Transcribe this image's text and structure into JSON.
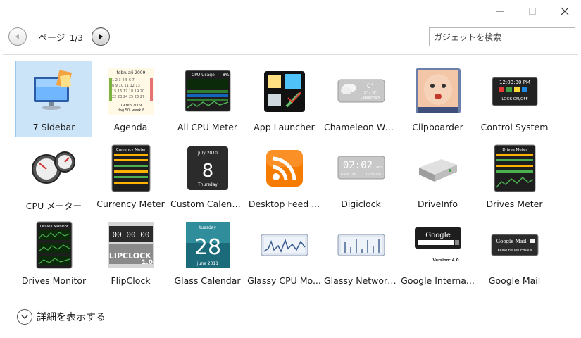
{
  "window": {
    "minimize_icon": "minimize-icon",
    "maximize_icon": "maximize-icon",
    "close_icon": "close-icon"
  },
  "nav": {
    "page_label": "ページ",
    "page_number": "1/3"
  },
  "search": {
    "placeholder": "ガジェットを検索"
  },
  "gadgets": [
    {
      "label": "7 Sidebar",
      "icon": "monitor-icon",
      "selected": true
    },
    {
      "label": "Agenda",
      "icon": "calendar-icon"
    },
    {
      "label": "All CPU Meter",
      "icon": "cpu-graph-icon"
    },
    {
      "label": "App Launcher",
      "icon": "app-launcher-icon"
    },
    {
      "label": "Chameleon We...",
      "icon": "weather-icon"
    },
    {
      "label": "Clipboarder",
      "icon": "baby-photo-icon"
    },
    {
      "label": "Control System",
      "icon": "control-system-icon"
    },
    {
      "label": "CPU メーター",
      "icon": "gauge-icon"
    },
    {
      "label": "Currency Meter",
      "icon": "currency-icon"
    },
    {
      "label": "Custom Calend...",
      "icon": "flip-calendar-icon"
    },
    {
      "label": "Desktop Feed ...",
      "icon": "rss-icon"
    },
    {
      "label": "Digiclock",
      "icon": "digital-clock-icon"
    },
    {
      "label": "DriveInfo",
      "icon": "hard-drive-icon"
    },
    {
      "label": "Drives Meter",
      "icon": "drives-meter-icon"
    },
    {
      "label": "Drives Monitor",
      "icon": "drives-monitor-icon"
    },
    {
      "label": "FlipClock",
      "icon": "flip-clock-icon"
    },
    {
      "label": "Glass Calendar",
      "icon": "glass-calendar-icon"
    },
    {
      "label": "Glassy CPU Mo...",
      "icon": "glassy-graph-icon"
    },
    {
      "label": "Glassy Network...",
      "icon": "network-graph-icon"
    },
    {
      "label": "Google Interna...",
      "icon": "google-search-icon"
    },
    {
      "label": "Google Mail",
      "icon": "mail-icon"
    }
  ],
  "thumbs": {
    "agenda_title": "februari 2009",
    "agenda_line1": "19 feb 2009",
    "agenda_line2": "dag 50, week 8",
    "cpu_title": "CPU Usage",
    "cpu_pct": "8%",
    "weather_temp": "0°",
    "weather_range": "2° / -3°",
    "weather_city": "Langemark",
    "ctrl_time": "12:03:30 PM",
    "ctrl_lock": "LOCK ON/OFF",
    "currency_title": "Currency Meter",
    "cal_month": "July 2010",
    "cal_day": "8",
    "cal_weekday": "Thursday",
    "digi_time": "02:02",
    "digi_am": "am",
    "digi_alarm": "Alarm Off",
    "digi_sub": "12:55 am",
    "drives_title": "Drives Meter",
    "monitor_title": "Drives Monitor",
    "flip_digits": "00 00 00",
    "flip_word": "FLIPCLOCK",
    "flip_ver": "1.0",
    "glass_weekday": "tuesday",
    "glass_day": "28",
    "glass_month": "june 2011",
    "google_logo": "Google",
    "google_version": "Version: 4.0",
    "gmail_title": "Google Mail",
    "gmail_sub": "Keine neuen Emails"
  },
  "details": {
    "label": "詳細を表示する"
  }
}
